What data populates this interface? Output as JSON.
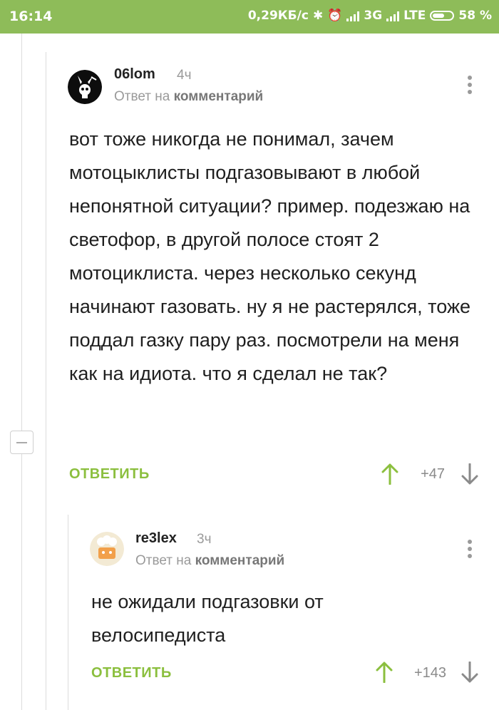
{
  "statusbar": {
    "time": "16:14",
    "speed": "0,29КБ/с",
    "net1": "3G",
    "net2": "LTE",
    "battery": "58 %"
  },
  "comments": [
    {
      "author": "06lom",
      "age": "4ч",
      "reply_prefix": "Ответ на",
      "reply_target": "комментарий",
      "text": "вот тоже никогда не понимал, зачем мотоцыклисты подгазовывают в любой непонятной ситуации? пример. подезжаю на светофор, в другой полосе стоят 2 мотоциклиста. через несколько секунд начинают газовать. ну я не растерялся, тоже поддал газку пару раз. посмотрели на меня как на идиота. что я сделал не так?",
      "reply_label": "ОТВЕТИТЬ",
      "score": "+47"
    },
    {
      "author": "re3lex",
      "age": "3ч",
      "reply_prefix": "Ответ на",
      "reply_target": "комментарий",
      "text": "не ожидали подгазовки от велосипедиста",
      "reply_label": "ОТВЕТИТЬ",
      "score": "+143"
    }
  ],
  "colors": {
    "accent_green": "#8bbf3e",
    "statusbar_green": "#8ebc59"
  },
  "icons": [
    "bluetooth-icon",
    "alarm-icon",
    "signal-icon",
    "battery-icon",
    "menu-dots-icon",
    "upvote-arrow-icon",
    "downvote-arrow-icon",
    "collapse-icon"
  ]
}
